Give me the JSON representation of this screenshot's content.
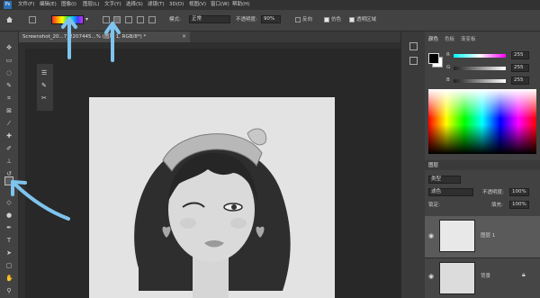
{
  "menu": [
    "文件(F)",
    "编辑(E)",
    "图像(I)",
    "图层(L)",
    "文字(Y)",
    "选择(S)",
    "滤镜(T)",
    "3D(D)",
    "视图(V)",
    "窗口(W)",
    "帮助(H)"
  ],
  "options": {
    "mode_label": "模式:",
    "mode_value": "正常",
    "opacity_label": "不透明度:",
    "opacity_value": "90%",
    "reverse_label": "反向",
    "dither_label": "仿色",
    "transparency_label": "透明区域"
  },
  "doc_tab": {
    "title": "Screenshot_20...7_2207445...% (图层 1, RGB/8*) *"
  },
  "color_panel": {
    "tabs": [
      "颜色",
      "色板",
      "渐变板"
    ],
    "channels": [
      {
        "label": "R",
        "value": "255"
      },
      {
        "label": "G",
        "value": "255"
      },
      {
        "label": "B",
        "value": "255"
      }
    ]
  },
  "layers_panel": {
    "tab": "图层",
    "kind": "类型",
    "blend_mode": "滤色",
    "opacity_label": "不透明度:",
    "opacity_value": "100%",
    "lock_label": "锁定:",
    "fill_label": "填充:",
    "fill_value": "100%",
    "layers": [
      {
        "name": "图层 1"
      },
      {
        "name": "背景"
      }
    ]
  },
  "colors": {
    "annotation_arrow": "#7ec4ee",
    "menubar": "#323232",
    "workspace": "#282828"
  }
}
